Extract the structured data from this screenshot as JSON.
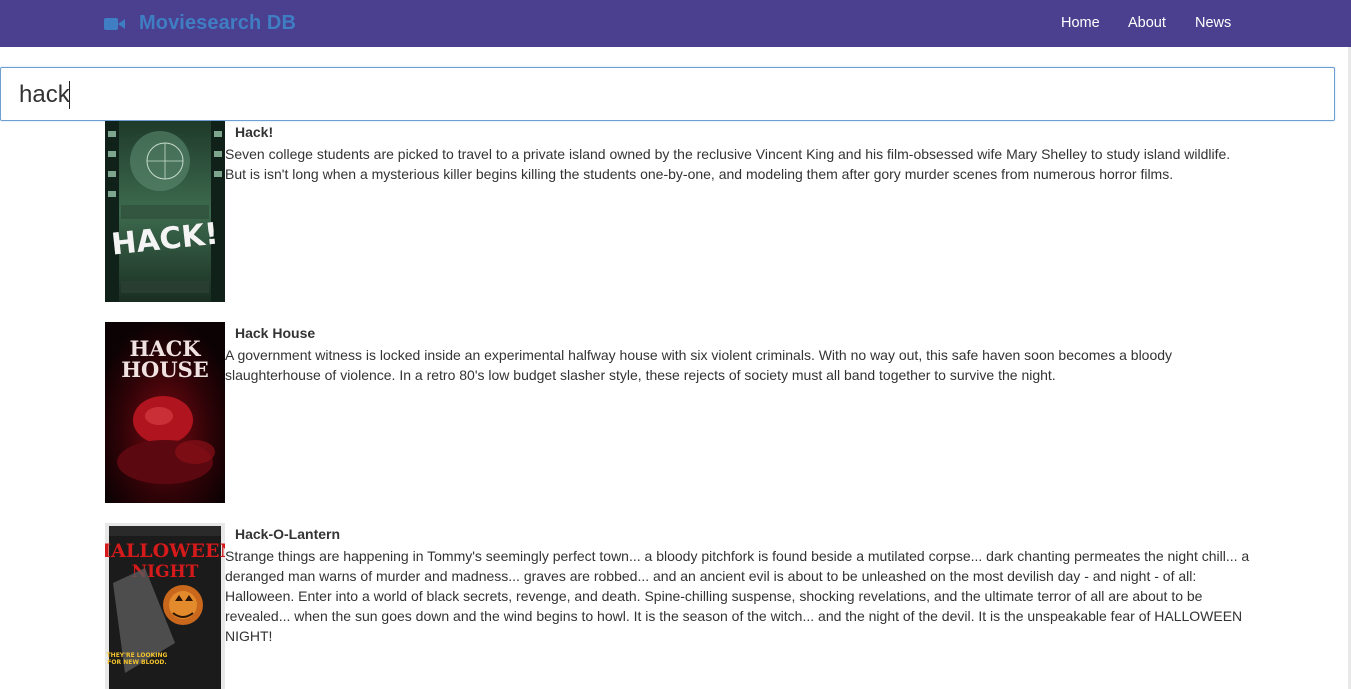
{
  "navbar": {
    "brand": "Moviesearch DB",
    "brand_icon": "video-camera-icon",
    "links": [
      "Home",
      "About",
      "News"
    ],
    "bg_color": "#4b3f8f",
    "brand_color": "#3f7ec3"
  },
  "search": {
    "value": "hack"
  },
  "results": [
    {
      "title": "Hack!",
      "poster_text": "HACK!",
      "description": "Seven college students are picked to travel to a private island owned by the reclusive Vincent King and his film-obsessed wife Mary Shelley to study island wildlife. But is isn't long when a mysterious killer begins killing the students one-by-one, and modeling them after gory murder scenes from numerous horror films."
    },
    {
      "title": "Hack House",
      "poster_text_line1": "HACK",
      "poster_text_line2": "HOUSE",
      "description": "A government witness is locked inside an experimental halfway house with six violent criminals. With no way out, this safe haven soon becomes a bloody slaughterhouse of violence. In a retro 80's low budget slasher style, these rejects of society must all band together to survive the night."
    },
    {
      "title": "Hack-O-Lantern",
      "poster_text_line1": "HALLOWEEN",
      "poster_text_line2": "NIGHT",
      "poster_tagline_1": "THEY'RE LOOKING",
      "poster_tagline_2": "FOR NEW BLOOD.",
      "description": "Strange things are happening in Tommy's seemingly perfect town... a bloody pitchfork is found beside a mutilated corpse... dark chanting permeates the night chill... a deranged man warns of murder and madness... graves are robbed... and an ancient evil is about to be unleashed on the most devilish day - and night - of all: Halloween. Enter into a world of black secrets, revenge, and death. Spine-chilling suspense, shocking revelations, and the ultimate terror of all are about to be revealed... when the sun goes down and the wind begins to howl. It is the season of the witch... and the night of the devil. It is the unspeakable fear of HALLOWEEN NIGHT!"
    }
  ]
}
